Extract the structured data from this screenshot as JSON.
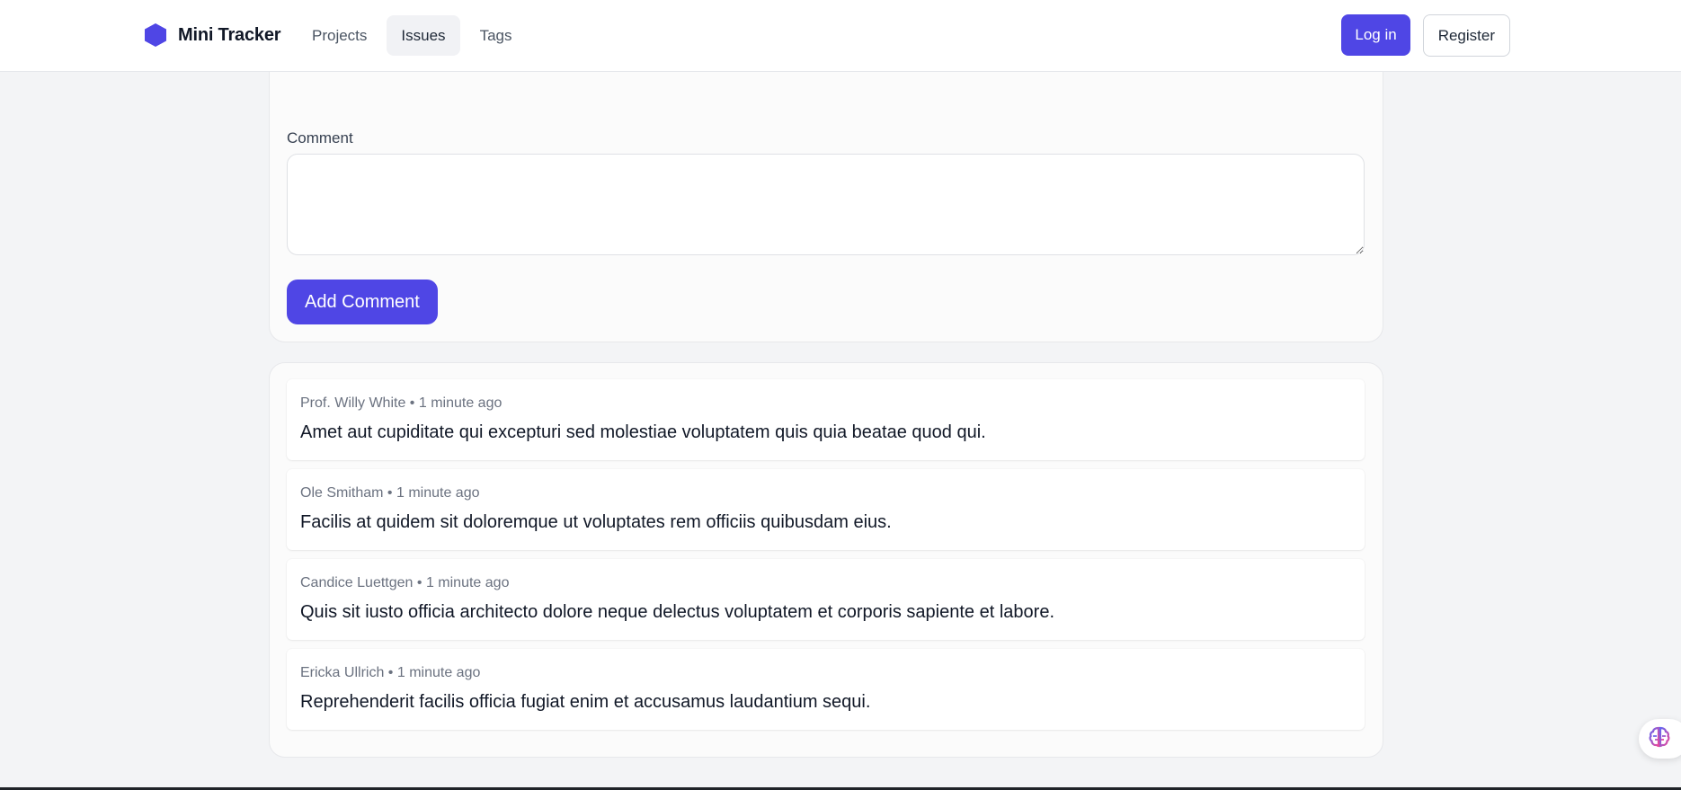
{
  "app": {
    "brand_name": "Mini Tracker",
    "brand_color": "#4f46e5"
  },
  "nav": {
    "items": [
      {
        "label": "Projects",
        "active": false
      },
      {
        "label": "Issues",
        "active": true
      },
      {
        "label": "Tags",
        "active": false
      }
    ]
  },
  "auth": {
    "login_label": "Log in",
    "register_label": "Register"
  },
  "form": {
    "comment_label": "Comment",
    "comment_value": "",
    "submit_label": "Add Comment"
  },
  "comments": [
    {
      "author": "Prof. Willy White",
      "time": "1 minute ago",
      "text": "Amet aut cupiditate qui excepturi sed molestiae voluptatem quis quia beatae quod qui."
    },
    {
      "author": "Ole Smitham",
      "time": "1 minute ago",
      "text": "Facilis at quidem sit doloremque ut voluptates rem officiis quibusdam eius."
    },
    {
      "author": "Candice Luettgen",
      "time": "1 minute ago",
      "text": "Quis sit iusto officia architecto dolore neque delectus voluptatem et corporis sapiente et labore."
    },
    {
      "author": "Ericka Ullrich",
      "time": "1 minute ago",
      "text": "Reprehenderit facilis officia fugiat enim et accusamus laudantium sequi."
    }
  ],
  "meta_separator": "•",
  "icons": {
    "brand": "hexagon-logo-icon",
    "floating": "brain-icon"
  }
}
